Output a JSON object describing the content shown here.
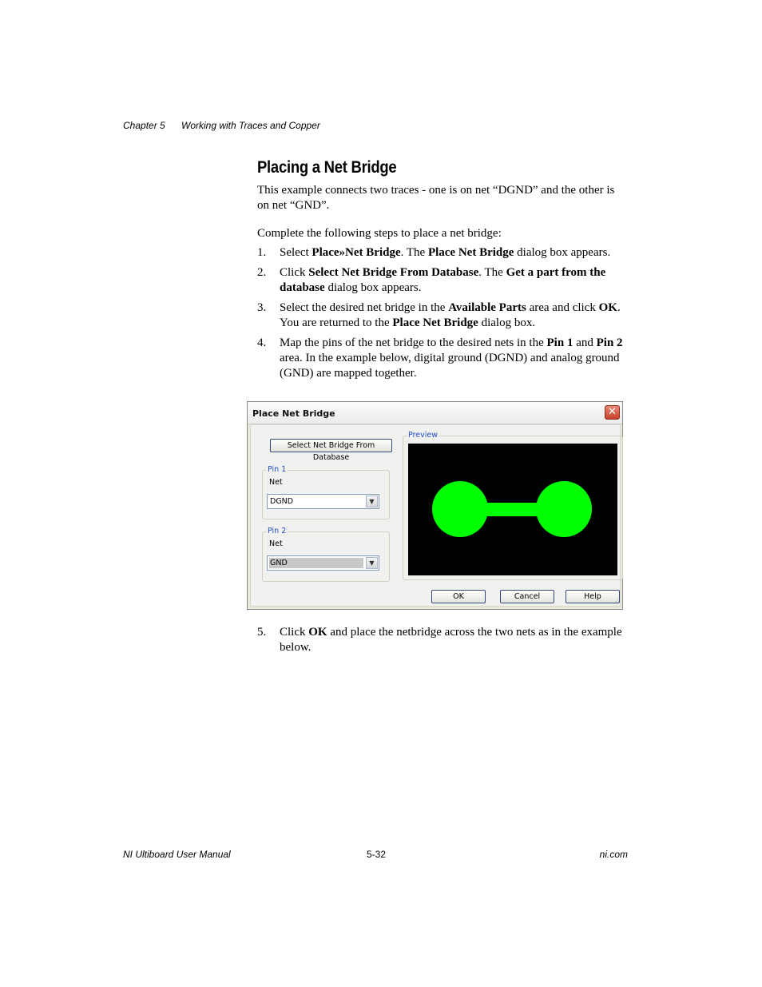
{
  "header": {
    "chapter": "Chapter 5",
    "chapter_title": "Working with Traces and Copper"
  },
  "section": {
    "title": "Placing a Net Bridge",
    "intro": "This example connects two traces - one is on net “DGND” and the other is on net “GND”.",
    "lead": "Complete the following steps to place a net bridge:"
  },
  "steps": [
    {
      "num": "1.",
      "parts": [
        {
          "t": "Select "
        },
        {
          "t": "Place»Net Bridge",
          "b": true
        },
        {
          "t": ". The "
        },
        {
          "t": "Place Net Bridge",
          "b": true
        },
        {
          "t": " dialog box appears."
        }
      ]
    },
    {
      "num": "2.",
      "parts": [
        {
          "t": "Click "
        },
        {
          "t": "Select Net Bridge From Database",
          "b": true
        },
        {
          "t": ". The "
        },
        {
          "t": "Get a part from the database",
          "b": true
        },
        {
          "t": " dialog box appears."
        }
      ]
    },
    {
      "num": "3.",
      "parts": [
        {
          "t": "Select the desired net bridge in the "
        },
        {
          "t": "Available Parts",
          "b": true
        },
        {
          "t": " area and click "
        },
        {
          "t": "OK",
          "b": true
        },
        {
          "t": ". You are returned to the "
        },
        {
          "t": "Place Net Bridge",
          "b": true
        },
        {
          "t": " dialog box."
        }
      ]
    },
    {
      "num": "4.",
      "parts": [
        {
          "t": "Map the pins of the net bridge to the desired nets in the "
        },
        {
          "t": "Pin 1",
          "b": true
        },
        {
          "t": " and "
        },
        {
          "t": "Pin 2",
          "b": true
        },
        {
          "t": " area. In the example below, digital ground (DGND) and analog ground (GND) are mapped together."
        }
      ]
    }
  ],
  "steps_after": [
    {
      "num": "5.",
      "parts": [
        {
          "t": "Click "
        },
        {
          "t": "OK",
          "b": true
        },
        {
          "t": " and place the netbridge across the two nets as in the example below."
        }
      ]
    }
  ],
  "dialog": {
    "title": "Place Net Bridge",
    "close_glyph": "✕",
    "select_button": "Select Net Bridge From Database",
    "pin1": {
      "legend": "Pin 1",
      "net_label": "Net",
      "net_value": "DGND"
    },
    "pin2": {
      "legend": "Pin 2",
      "net_label": "Net",
      "net_value": "GND"
    },
    "preview_legend": "Preview",
    "preview_colors": {
      "background": "#000000",
      "bridge": "#00ff00"
    },
    "ok": "OK",
    "cancel": "Cancel",
    "help": "Help"
  },
  "footer": {
    "manual": "NI Ultiboard User Manual",
    "page": "5-32",
    "site": "ni.com"
  }
}
